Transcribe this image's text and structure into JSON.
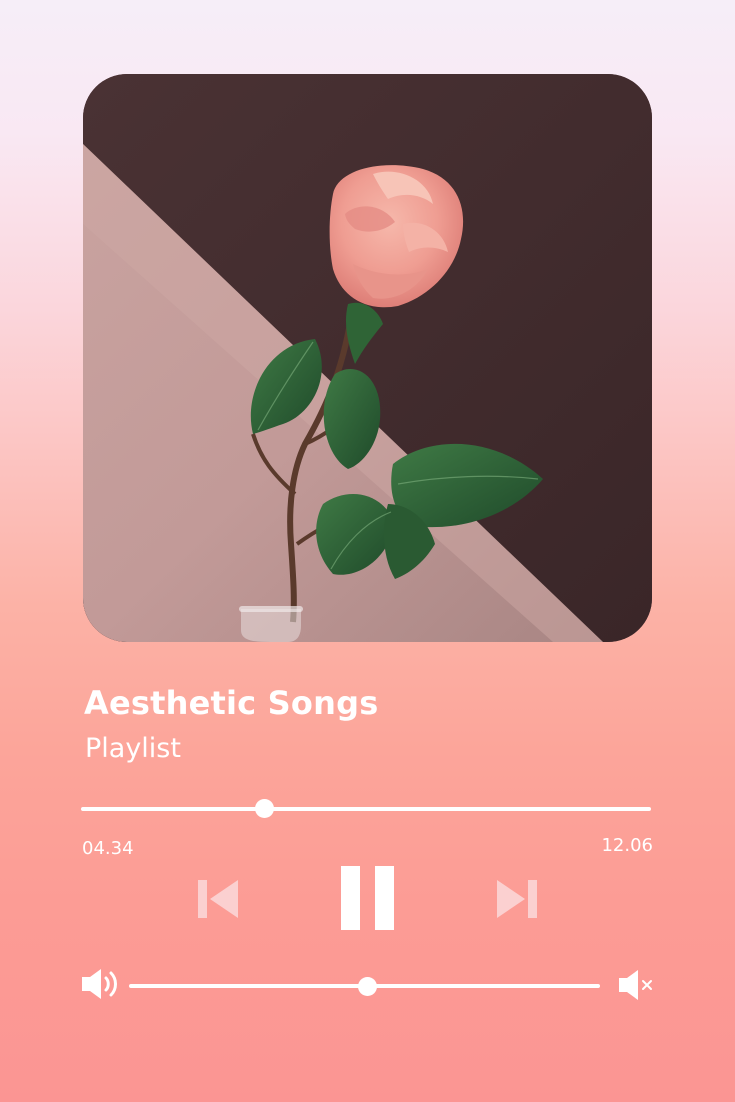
{
  "player": {
    "title": "Aesthetic Songs",
    "subtitle": "Playlist",
    "artwork": "rose-in-glass-vase",
    "elapsed": "04.34",
    "duration": "12.06",
    "progress_fraction": 0.32,
    "volume_fraction": 0.5,
    "state": "playing"
  },
  "icons": {
    "previous": "previous-track-icon",
    "pause": "pause-icon",
    "next": "next-track-icon",
    "volume": "volume-up-icon",
    "mute": "volume-mute-icon"
  },
  "colors": {
    "foreground": "#ffffff",
    "controls_soft": "#fbd0d0",
    "background_top": "#f6eef8",
    "background_bottom": "#fb9593"
  }
}
